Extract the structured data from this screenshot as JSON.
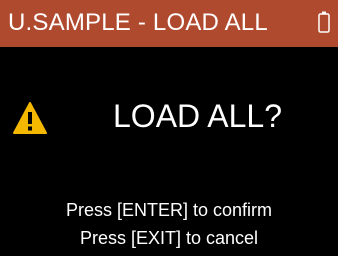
{
  "header": {
    "title": "U.SAMPLE - LOAD ALL",
    "icon": "battery-icon"
  },
  "dialog": {
    "icon": "warning-icon",
    "heading": "LOAD ALL?",
    "line1": "Press [ENTER] to confirm",
    "line2": "Press [EXIT] to cancel"
  },
  "colors": {
    "titlebar_bg": "#b04a2e",
    "warning": "#f5b800",
    "text": "#ffffff",
    "background": "#000000"
  }
}
